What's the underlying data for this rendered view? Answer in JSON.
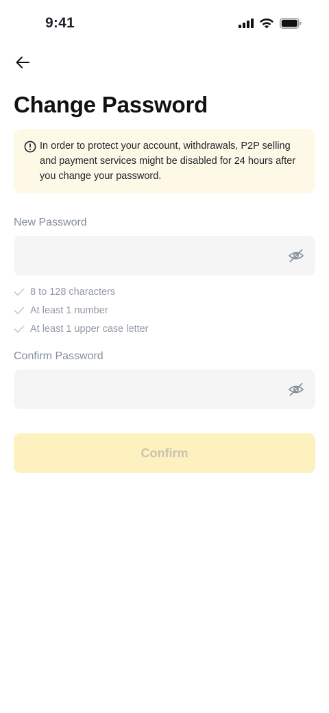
{
  "status_bar": {
    "time": "9:41",
    "icons": [
      "cellular-signal-icon",
      "wifi-icon",
      "battery-icon"
    ]
  },
  "header": {
    "back_icon": "arrow-left-icon",
    "title": "Change Password"
  },
  "notice": {
    "icon": "info-circle-icon",
    "text": "In order to protect your account, withdrawals, P2P selling and payment services might be disabled for 24 hours after you change your password.",
    "background": "#fef8e6"
  },
  "new_password": {
    "label": "New Password",
    "value": "",
    "placeholder": "",
    "toggle_icon": "eye-off-icon"
  },
  "rules": [
    {
      "icon": "check-icon",
      "text": "8 to 128 characters"
    },
    {
      "icon": "check-icon",
      "text": "At least 1 number"
    },
    {
      "icon": "check-icon",
      "text": "At least 1 upper case letter"
    }
  ],
  "confirm_password": {
    "label": "Confirm Password",
    "value": "",
    "placeholder": "",
    "toggle_icon": "eye-off-icon"
  },
  "confirm_button": {
    "label": "Confirm",
    "state": "disabled",
    "background": "#fdf1bf"
  }
}
